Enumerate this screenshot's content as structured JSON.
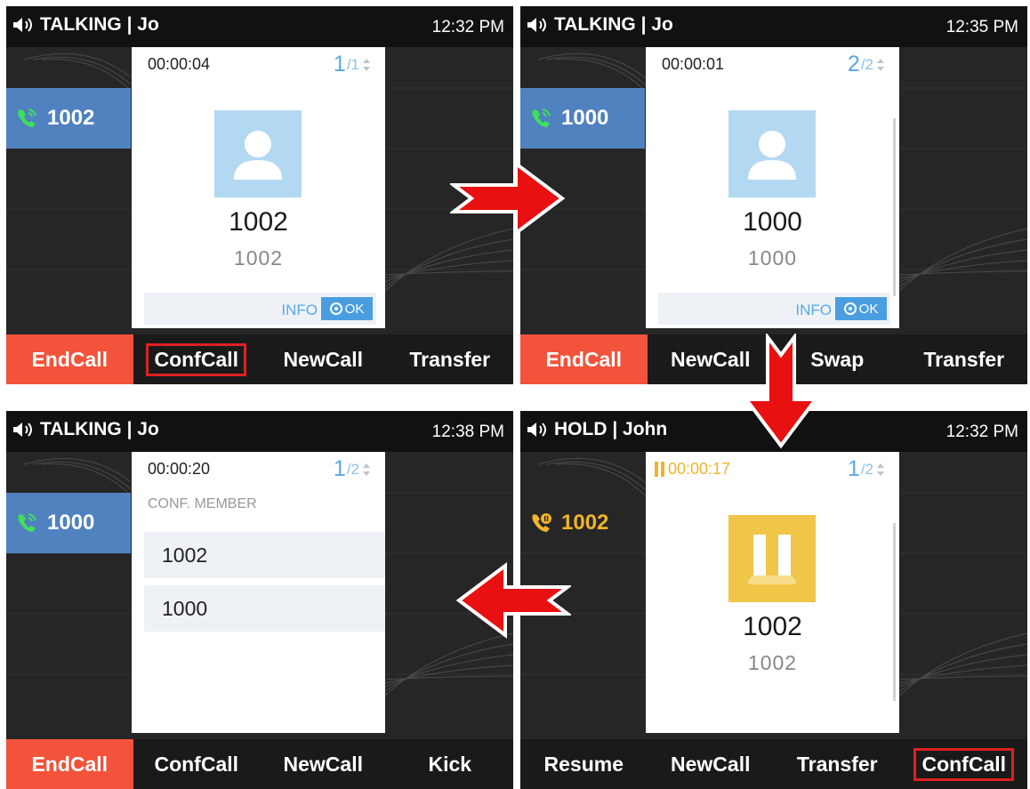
{
  "screens": [
    {
      "status": "TALKING | Jo",
      "time": "12:32 PM",
      "line": "1002",
      "timer": "00:00:04",
      "page_current": "1",
      "page_total": "/1",
      "name_big": "1002",
      "name_small": "1002",
      "info": "INFO",
      "ok": "OK",
      "softkeys": [
        "EndCall",
        "ConfCall",
        "NewCall",
        "Transfer"
      ]
    },
    {
      "status": "TALKING | Jo",
      "time": "12:35 PM",
      "line": "1000",
      "timer": "00:00:01",
      "page_current": "2",
      "page_total": "/2",
      "name_big": "1000",
      "name_small": "1000",
      "info": "INFO",
      "ok": "OK",
      "softkeys": [
        "EndCall",
        "NewCall",
        "Swap",
        "Transfer"
      ]
    },
    {
      "status": "TALKING | Jo",
      "time": "12:38 PM",
      "line": "1000",
      "timer": "00:00:20",
      "page_current": "1",
      "page_total": "/2",
      "conf_title": "CONF. MEMBER",
      "members": [
        "1002",
        "1000"
      ],
      "softkeys": [
        "EndCall",
        "ConfCall",
        "NewCall",
        "Kick"
      ]
    },
    {
      "status": "HOLD | John",
      "time": "12:32 PM",
      "line": "1002",
      "timer": "00:00:17",
      "page_current": "1",
      "page_total": "/2",
      "name_big": "1002",
      "name_small": "1002",
      "softkeys": [
        "Resume",
        "NewCall",
        "Transfer",
        "ConfCall"
      ]
    }
  ],
  "colors": {
    "active_line": "#4f82bf",
    "end_call": "#f2533a",
    "hold": "#f0b429",
    "highlight_box": "#e02020",
    "arrow": "#e81010"
  }
}
